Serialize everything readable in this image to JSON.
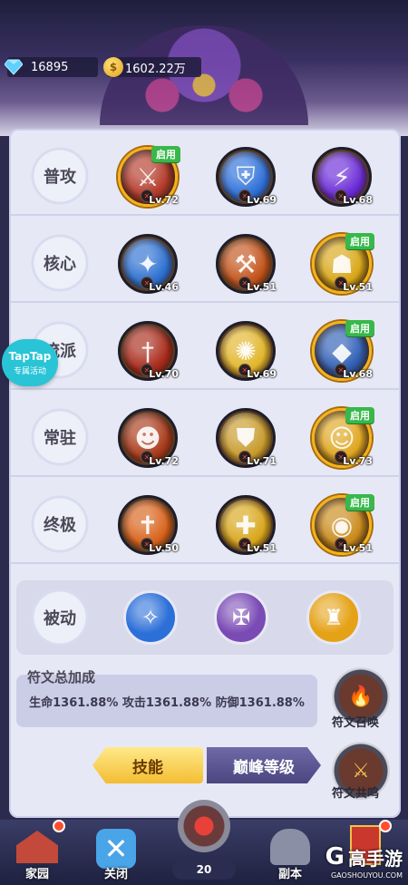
{
  "currency": {
    "gems": "16895",
    "coins": "1602.22万",
    "coin_symbol": "$"
  },
  "rows": [
    {
      "label": "普攻",
      "skills": [
        {
          "level": "Lv.72",
          "badge": "启用",
          "color": "#b33a2a"
        },
        {
          "level": "Lv.69",
          "badge": "",
          "color": "#2c6fd8"
        },
        {
          "level": "Lv.68",
          "badge": "",
          "color": "#6a2ad8"
        }
      ]
    },
    {
      "label": "核心",
      "skills": [
        {
          "level": "Lv.46",
          "badge": "",
          "color": "#2b6fd0"
        },
        {
          "level": "Lv.51",
          "badge": "",
          "color": "#c2531a"
        },
        {
          "level": "Lv.51",
          "badge": "启用",
          "color": "#d8a616"
        }
      ]
    },
    {
      "label": "流派",
      "skills": [
        {
          "level": "Lv.70",
          "badge": "",
          "color": "#a82a1a"
        },
        {
          "level": "Lv.69",
          "badge": "",
          "color": "#e2b52a"
        },
        {
          "level": "Lv.68",
          "badge": "启用",
          "color": "#2f5fb5"
        }
      ]
    },
    {
      "label": "常驻",
      "skills": [
        {
          "level": "Lv.72",
          "badge": "",
          "color": "#a83a1a"
        },
        {
          "level": "Lv.71",
          "badge": "",
          "color": "#c79a2a"
        },
        {
          "level": "Lv.73",
          "badge": "启用",
          "color": "#e0a620"
        }
      ]
    },
    {
      "label": "终极",
      "skills": [
        {
          "level": "Lv.50",
          "badge": "",
          "color": "#d8621a"
        },
        {
          "level": "Lv.51",
          "badge": "",
          "color": "#d8a61a"
        },
        {
          "level": "Lv.51",
          "badge": "启用",
          "color": "#c98a1a"
        }
      ]
    }
  ],
  "passive": {
    "label": "被动",
    "skills": [
      {
        "color": "#2c6fd8"
      },
      {
        "color": "#7a4bb5"
      },
      {
        "color": "#e5a216"
      }
    ]
  },
  "bonus": {
    "title": "符文总加成",
    "text": "生命1361.88% 攻击1361.88% 防御1361.88%"
  },
  "rune_summon": {
    "label": "符文召唤"
  },
  "rune_resonance": {
    "label": "符文共鸣"
  },
  "tabs": {
    "skill": "技能",
    "peak": "巅峰等级"
  },
  "taptap": {
    "title": "TapTap",
    "subtitle": "专属活动"
  },
  "nav": {
    "home": "家园",
    "close": "关闭",
    "center_count": "20",
    "dungeon": "副本"
  },
  "watermark": {
    "logo": "G",
    "name": "高手游",
    "url": "GAOSHOUYOU.COM"
  }
}
